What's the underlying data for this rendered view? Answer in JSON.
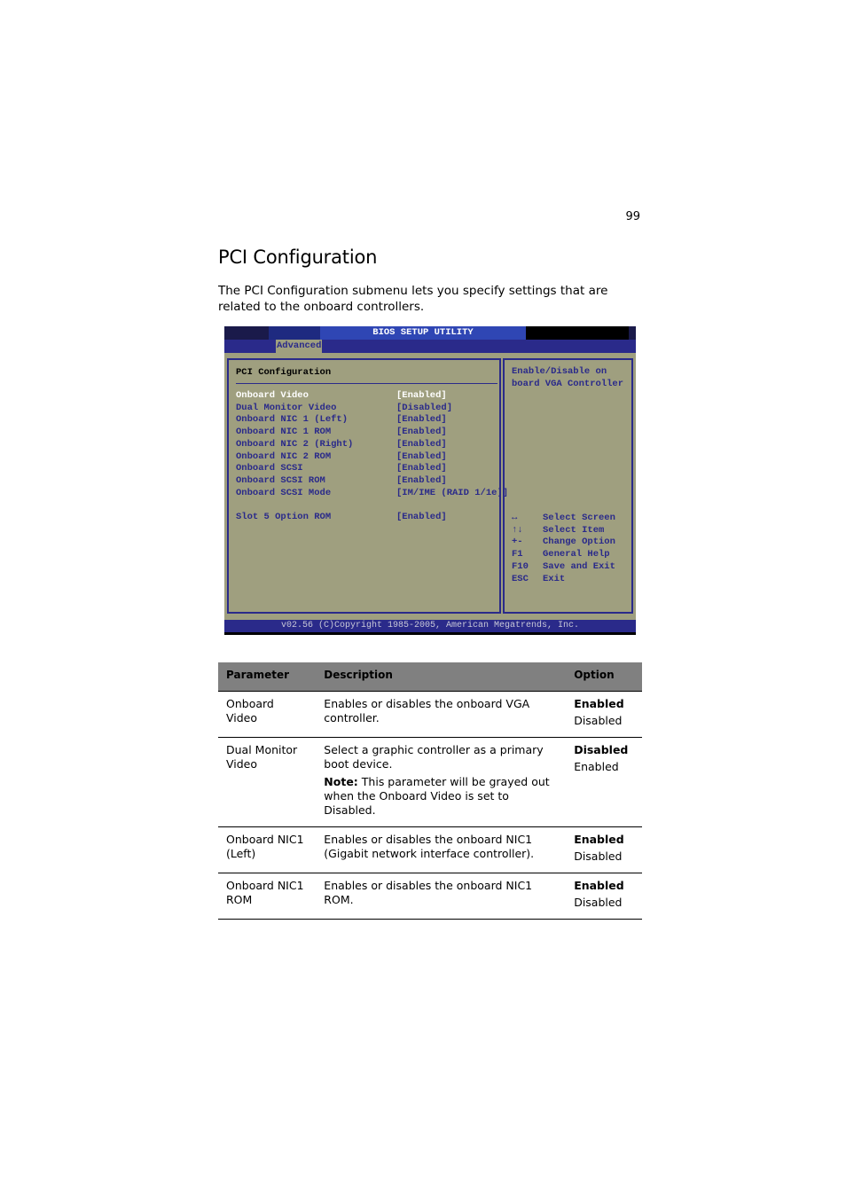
{
  "page": {
    "number": "99",
    "title": "PCI Configuration",
    "intro": "The PCI Configuration submenu lets you specify settings that are related to the onboard controllers."
  },
  "bios": {
    "title": "BIOS SETUP UTILITY",
    "tab": "Advanced",
    "section": "PCI Configuration",
    "items": [
      {
        "label": "Onboard Video",
        "value": "[Enabled]",
        "selected": true
      },
      {
        "label": "Dual Monitor Video",
        "value": "[Disabled]"
      },
      {
        "label": "Onboard NIC 1 (Left)",
        "value": "[Enabled]"
      },
      {
        "label": "Onboard NIC 1 ROM",
        "value": "[Enabled]"
      },
      {
        "label": "Onboard NIC 2 (Right)",
        "value": "[Enabled]"
      },
      {
        "label": "Onboard NIC 2 ROM",
        "value": "[Enabled]"
      },
      {
        "label": "Onboard SCSI",
        "value": "[Enabled]"
      },
      {
        "label": "Onboard SCSI ROM",
        "value": "[Enabled]"
      },
      {
        "label": "Onboard SCSI Mode",
        "value": "[IM/IME (RAID 1/1e)]"
      },
      {
        "label": "Slot 5 Option ROM",
        "value": "[Enabled]"
      }
    ],
    "help_line1": "Enable/Disable on",
    "help_line2": "board VGA Controller",
    "keys": [
      {
        "key": "↔",
        "action": "Select Screen"
      },
      {
        "key": "↑↓",
        "action": "Select Item"
      },
      {
        "key": "+-",
        "action": "Change Option"
      },
      {
        "key": "F1",
        "action": "General Help"
      },
      {
        "key": "F10",
        "action": "Save and Exit"
      },
      {
        "key": "ESC",
        "action": "Exit"
      }
    ],
    "footer": "v02.56 (C)Copyright 1985-2005, American Megatrends, Inc."
  },
  "table": {
    "headers": [
      "Parameter",
      "Description",
      "Option"
    ],
    "rows": [
      {
        "parameter": "Onboard Video",
        "description": "Enables or disables the onboard VGA controller.",
        "note_label": "",
        "note": "",
        "default": "Enabled",
        "alternate": "Disabled"
      },
      {
        "parameter": "Dual Monitor Video",
        "description": "Select a graphic controller as a primary boot device.",
        "note_label": "Note:",
        "note": " This parameter will be grayed out when the Onboard Video is set to Disabled.",
        "default": "Disabled",
        "alternate": "Enabled"
      },
      {
        "parameter": "Onboard NIC1 (Left)",
        "description": "Enables or disables the onboard NIC1 (Gigabit network interface controller).",
        "note_label": "",
        "note": "",
        "default": "Enabled",
        "alternate": "Disabled"
      },
      {
        "parameter": "Onboard NIC1 ROM",
        "description": "Enables or disables the onboard NIC1 ROM.",
        "note_label": "",
        "note": "",
        "default": "Enabled",
        "alternate": "Disabled"
      }
    ]
  }
}
